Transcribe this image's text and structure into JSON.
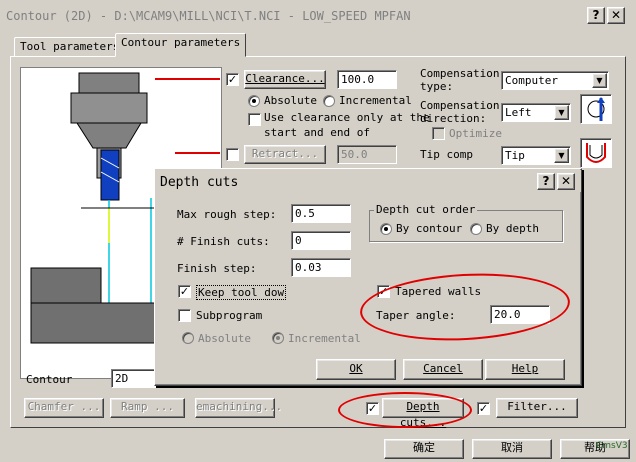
{
  "window": {
    "title": "Contour (2D) - D:\\MCAM9\\MILL\\NCI\\T.NCI - LOW_SPEED MPFAN",
    "help_label": "?",
    "close_label": "✕"
  },
  "tabs": [
    {
      "label": "Tool parameters"
    },
    {
      "label": "Contour parameters"
    }
  ],
  "clearance": {
    "label": "Clearance...",
    "value": "100.0",
    "checked": true
  },
  "absolute_label": "Absolute",
  "incremental_label": "Incremental",
  "use_clearance": {
    "line1": "Use clearance only at the",
    "line2": "start and end of"
  },
  "retract": {
    "label": "Retract...",
    "value": "50.0"
  },
  "compensation": {
    "type_label_1": "Compensation",
    "type_label_2": "type:",
    "type_value": "Computer",
    "dir_label_1": "Compensation",
    "dir_label_2": "direction:",
    "dir_value": "Left",
    "optimize_label": "Optimize"
  },
  "tip_comp": {
    "label": "Tip comp",
    "value": "Tip"
  },
  "contour": {
    "label": "Contour",
    "value": "2D"
  },
  "bottom_buttons": {
    "chamfer": "Chamfer ...",
    "ramp": "Ramp ...",
    "remachining": "emachining...",
    "depth_cuts": "Depth cuts...",
    "filter": "Filter..."
  },
  "footer": {
    "ok": "确定",
    "cancel": "取消",
    "help": "帮助"
  },
  "watermark": "CmsV3",
  "depth_dialog": {
    "title": "Depth cuts",
    "max_rough_step": {
      "label": "Max rough step:",
      "value": "0.5"
    },
    "finish_cuts": {
      "label": "# Finish cuts:",
      "value": "0"
    },
    "finish_step": {
      "label": "Finish step:",
      "value": "0.03"
    },
    "keep_tool_down": {
      "label": "Keep tool dow",
      "checked": true
    },
    "subprogram": {
      "label": "Subprogram",
      "checked": false
    },
    "sub_absolute": "Absolute",
    "sub_incremental": "Incremental",
    "order_group": "Depth cut order",
    "by_contour": "By contour",
    "by_depth": "By depth",
    "tapered_walls": {
      "label": "Tapered walls",
      "checked": true
    },
    "taper_angle": {
      "label": "Taper angle:",
      "value": "20.0"
    },
    "ok": "OK",
    "cancel": "Cancel",
    "help": "Help"
  },
  "colors": {
    "annotation": "#e00000",
    "yellow_line": "#ffff00",
    "cyan_line": "#00c8e0",
    "tool_blue": "#1040c0"
  }
}
